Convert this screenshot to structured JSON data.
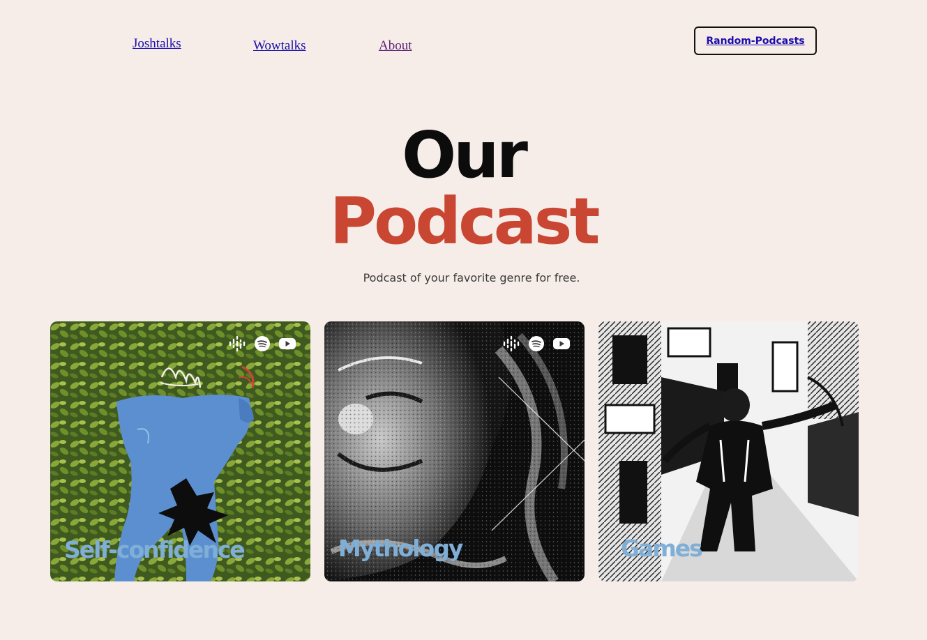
{
  "nav": {
    "links": [
      "Joshtalks",
      "Wowtalks",
      "About"
    ],
    "random_button": "Random-Podcasts"
  },
  "hero": {
    "title_line1": "Our",
    "title_line2": "Podcast",
    "subtitle": "Podcast of your favorite genre for free."
  },
  "cards": [
    {
      "label": "Self-confidence",
      "platform_icons": [
        "google-podcasts-icon",
        "spotify-icon",
        "youtube-icon"
      ]
    },
    {
      "label": "Mythology",
      "platform_icons": [
        "google-podcasts-icon",
        "spotify-icon",
        "youtube-icon"
      ]
    },
    {
      "label": "Games",
      "platform_icons": []
    }
  ],
  "colors": {
    "background": "#f6ede9",
    "title_dark": "#0c0c0c",
    "title_accent": "#c84632",
    "card_label": "#7faed6",
    "link": "#1a0dab",
    "link_visited": "#5c1f73"
  }
}
